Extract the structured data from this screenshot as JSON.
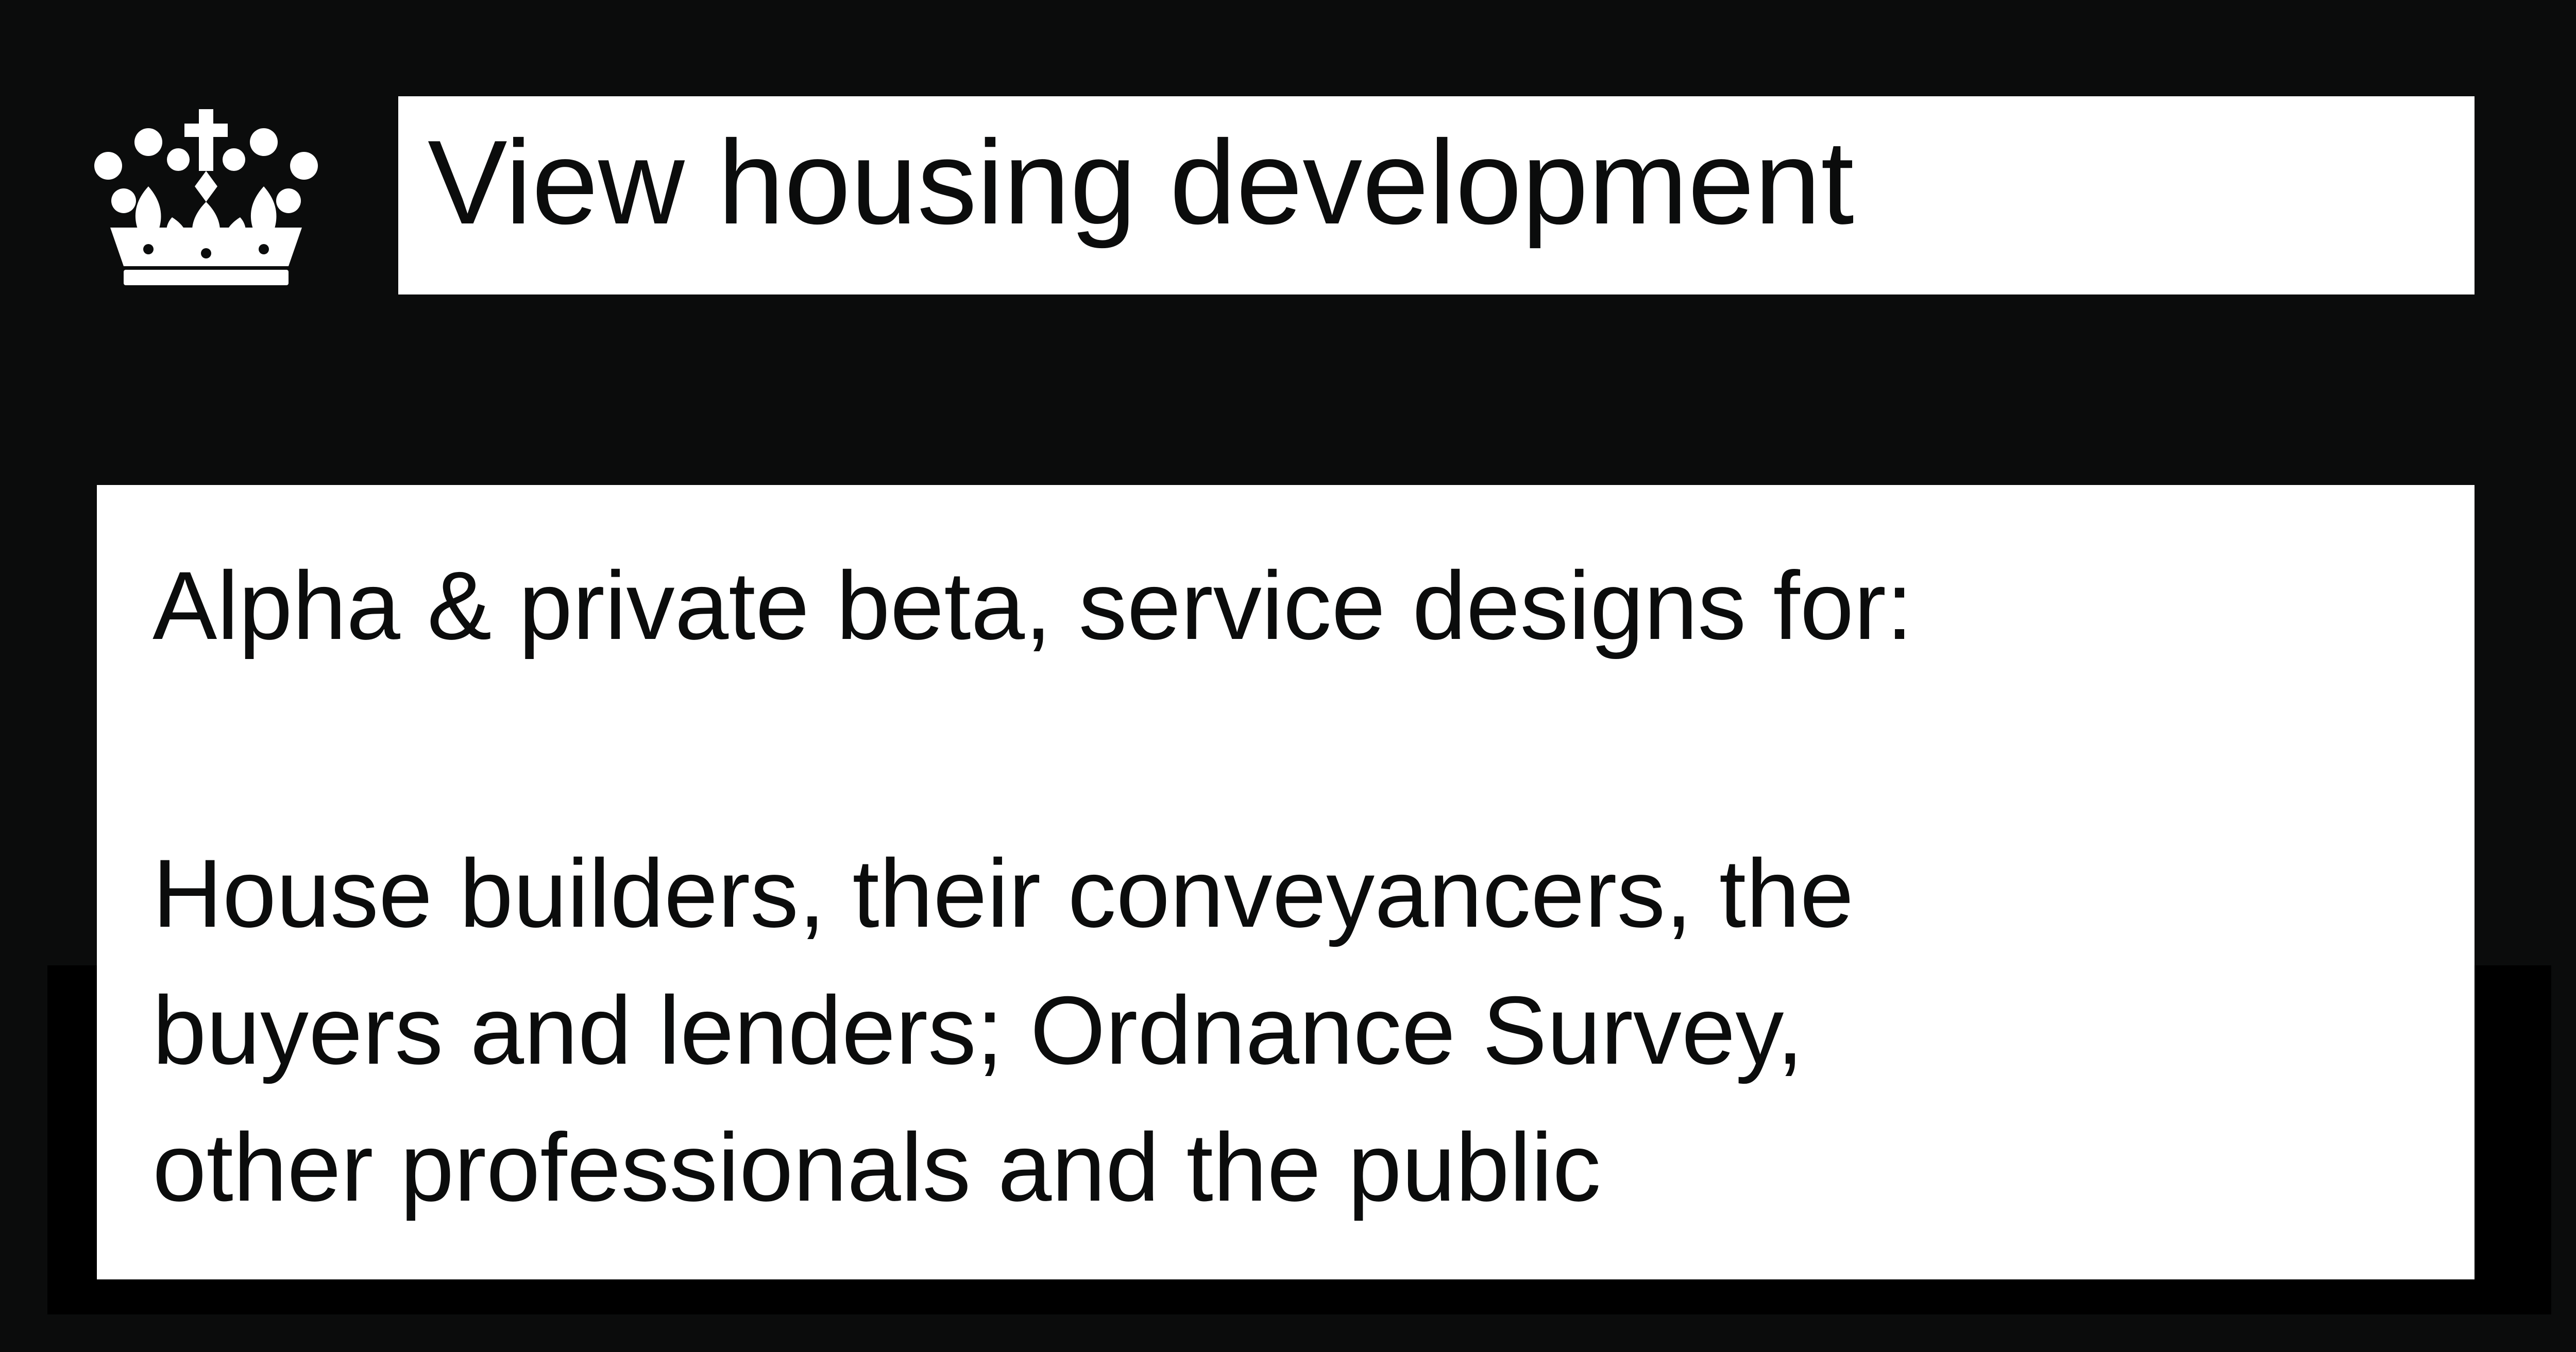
{
  "logo": {
    "icon": "crown-icon",
    "color": "#ffffff"
  },
  "header": {
    "title": "View housing development"
  },
  "panel": {
    "heading": "Alpha & private beta, service designs for:",
    "lines": [
      "House builders, their conveyancers, the",
      "buyers and lenders; Ordnance Survey,",
      "other professionals and the public"
    ]
  },
  "colors": {
    "background": "#0b0c0c",
    "panel": "#ffffff",
    "text": "#0b0c0c"
  }
}
